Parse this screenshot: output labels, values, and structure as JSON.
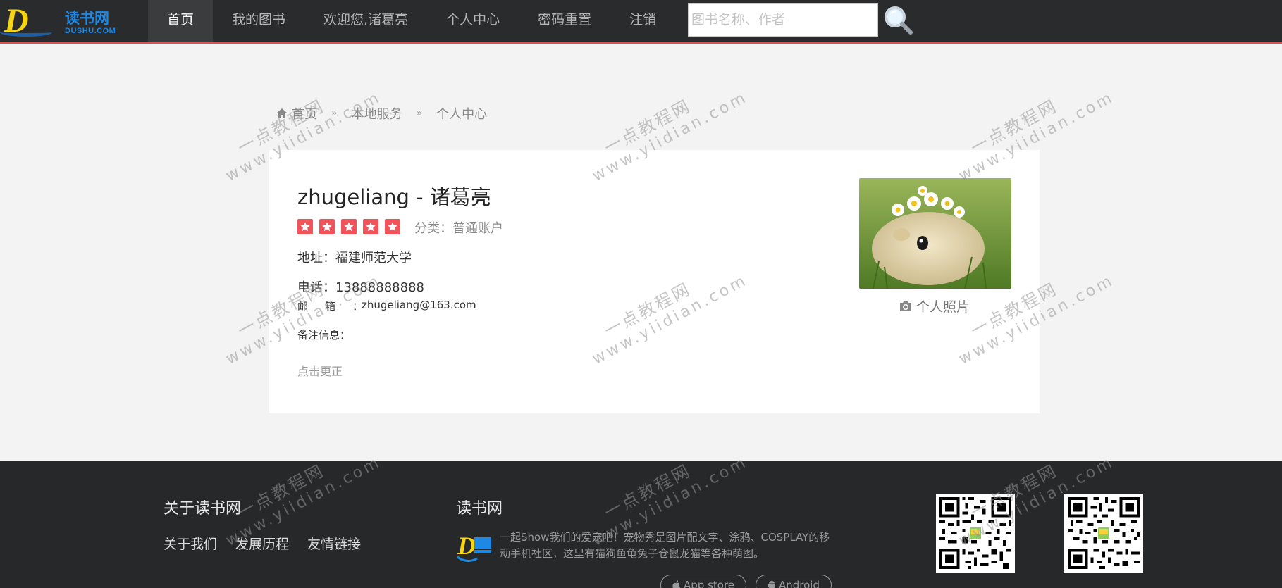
{
  "header": {
    "logo_cn": "读书网",
    "logo_en": "DUSHU.COM",
    "nav": [
      {
        "label": "首页",
        "active": true
      },
      {
        "label": "我的图书",
        "active": false
      },
      {
        "label": "欢迎您,诸葛亮",
        "active": false
      },
      {
        "label": "个人中心",
        "active": false
      },
      {
        "label": "密码重置",
        "active": false
      },
      {
        "label": "注销",
        "active": false
      }
    ],
    "search_placeholder": "图书名称、作者",
    "search_icon": "magnifier-icon"
  },
  "breadcrumb": [
    "首页",
    "本地服务",
    "个人中心"
  ],
  "profile": {
    "title": "zhugeliang - 诸葛亮",
    "rating": 5,
    "category": "分类：普通账户",
    "address": "地址：福建师范大学",
    "phone": "电话：13888888888",
    "email_label": "邮箱：",
    "email_value": "zhugeliang@163.com",
    "remark": "备注信息：",
    "edit_link": "点击更正",
    "photo_caption": "个人照片"
  },
  "footer": {
    "about_title": "关于读书网",
    "links": [
      "关于我们",
      "发展历程",
      "友情链接"
    ],
    "site_title": "读书网",
    "description": "一起Show我们的爱宠吧！宠物秀是图片配文字、涂鸦、COSPLAY的移动手机社区，这里有猫狗鱼龟兔子仓鼠龙猫等各种萌图。",
    "app_store": "App store",
    "android": "Android"
  },
  "watermark": {
    "line1": "一点教程网",
    "line2": "www.yiidian.com"
  },
  "colors": {
    "header_bg": "#2a2b2d",
    "accent_red": "#d9534f",
    "star_red": "#f0535a",
    "footer_bg": "#27282a",
    "logo_yellow": "#f7d512",
    "logo_blue": "#1e88e5"
  }
}
